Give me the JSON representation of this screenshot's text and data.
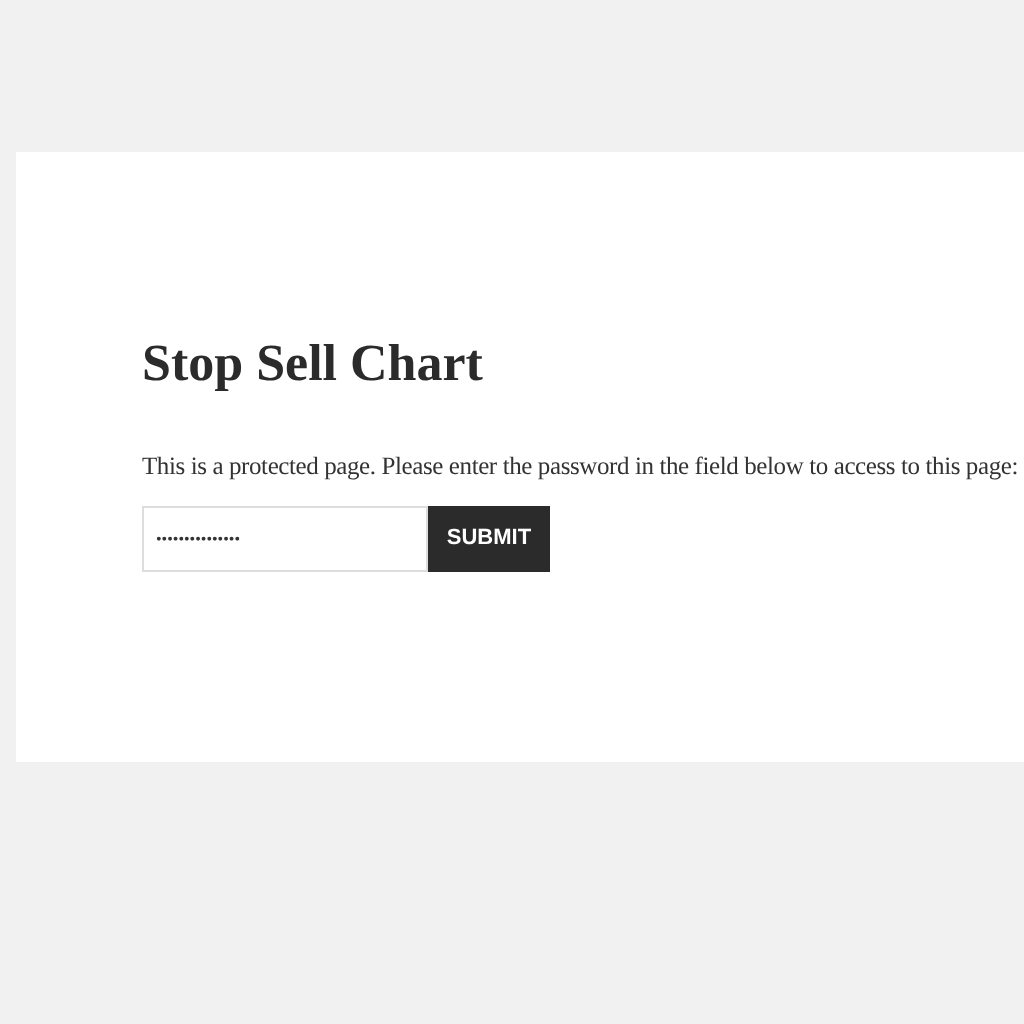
{
  "title": "Stop Sell Chart",
  "message": "This is a protected page. Please enter the password in the field below to access to this page:",
  "password_field": {
    "value": "•••••••••••••••"
  },
  "submit_button": {
    "label": "SUBMIT"
  }
}
